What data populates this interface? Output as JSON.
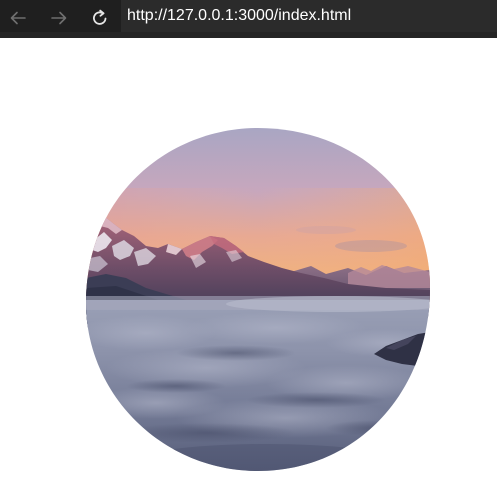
{
  "browser": {
    "url": "http://127.0.0.1:3000/index.html",
    "icons": {
      "back": "arrow-left-icon",
      "forward": "arrow-right-icon",
      "reload": "reload-icon"
    },
    "colors": {
      "toolbar": "#1f1f1f",
      "address_bar": "#2b2b2b",
      "url_text": "#ffffff",
      "icon_disabled": "#6f6f6f",
      "icon_enabled": "#e6e6e6"
    }
  },
  "page": {
    "image": {
      "subject": "mountain-sunset-sea-of-clouds",
      "shape": "rounded-blob"
    },
    "colors": {
      "background": "#ffffff"
    }
  }
}
